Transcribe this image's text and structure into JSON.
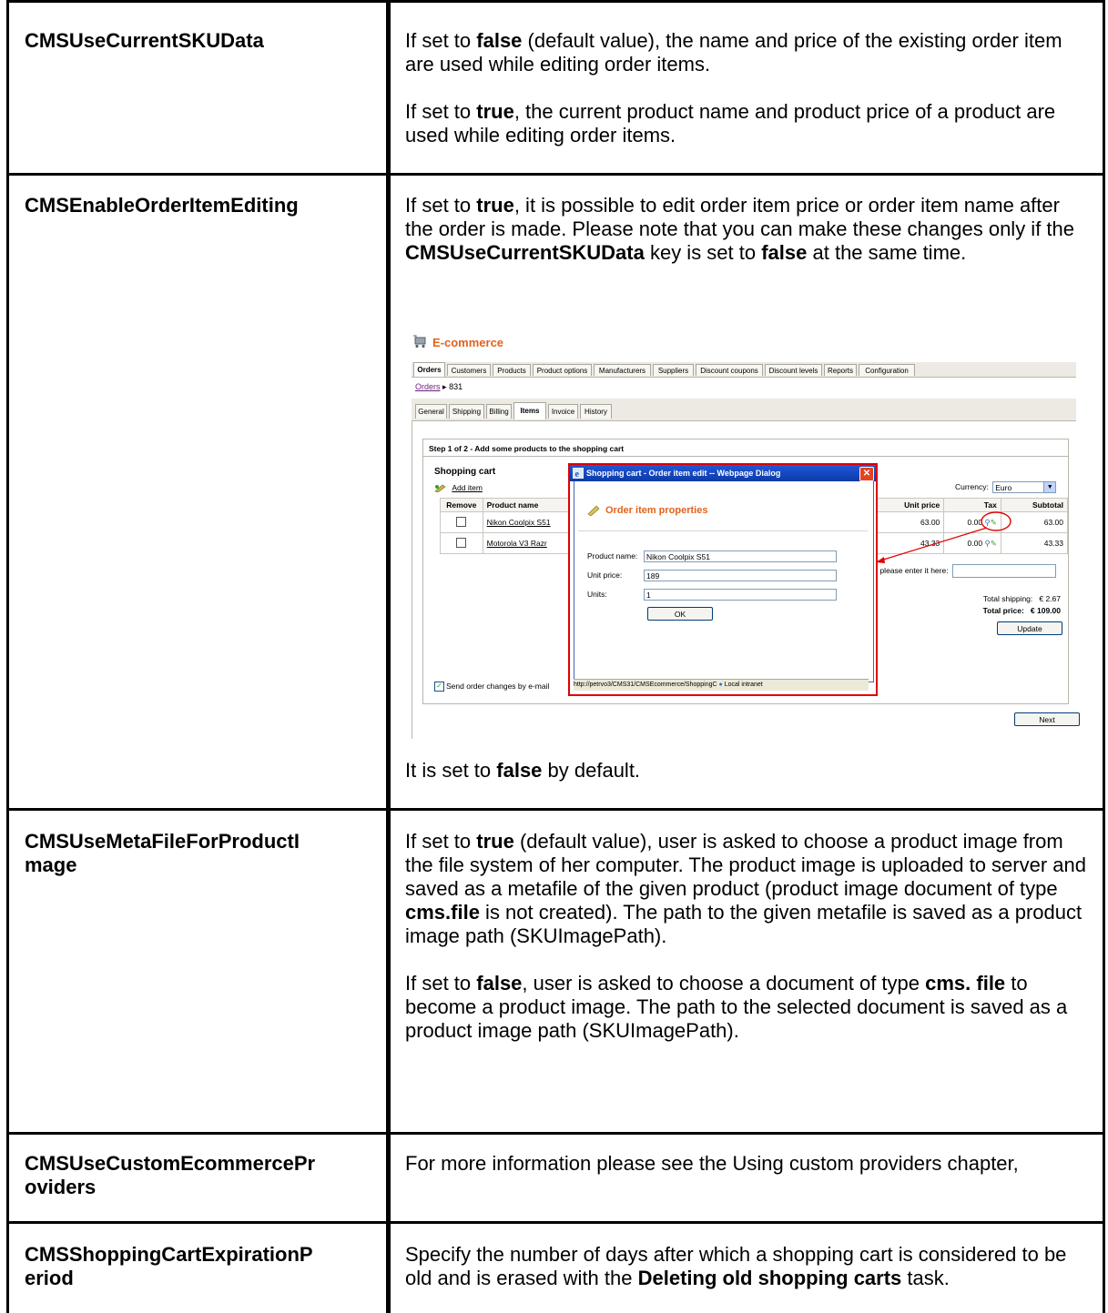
{
  "rows": [
    {
      "key": "CMSUseCurrentSKUData",
      "p1": {
        "a": "If set to ",
        "b": "false",
        "c": " (default value), the name and price of the existing order item are used while editing order  items."
      },
      "p2": {
        "a": "If set to ",
        "b": "true",
        "c": ", the current product name and product price of a product are used while editing order items."
      }
    },
    {
      "key": "CMSEnableOrderItemEditing",
      "p1": {
        "a": "If set to ",
        "b": "true",
        "c": ", it is possible to edit order item price or order item name after the order is made. Please note that you can make these changes only if the ",
        "d": "CMSUseCurrentSKUData",
        "e": " key is set to ",
        "f": "false",
        "g": " at the same time."
      },
      "p2": {
        "a": "It is set to ",
        "b": "false",
        "c": " by default."
      }
    },
    {
      "key": "CMSUseMetaFileForProductImage",
      "key_line1": "CMSUseMetaFileForProductI",
      "key_line2": "mage",
      "p1": {
        "a": "If set to ",
        "b": "true",
        "c": " (default value), user is asked to choose a product image from the file system of her computer. The product image is uploaded to server and saved as a metafile of the given product (product image document of type ",
        "d": "cms.file",
        "e": " is not created).  The path to the given metafile is saved as a product image path (SKUImagePath)."
      },
      "p2": {
        "a": "If set to ",
        "b": "false",
        "c": ", user is asked to choose a document of type ",
        "d": "cms. file",
        "e": " to become a product image. The path to the selected document is saved as a product image path (SKUImagePath)."
      }
    },
    {
      "key": "CMSUseCustomEcommerceProviders",
      "key_line1": "CMSUseCustomEcommercePr",
      "key_line2": "oviders",
      "p1": {
        "a": "For more information please see the Using custom providers chapter,"
      }
    },
    {
      "key": "CMSShoppingCartExpirationPeriod",
      "key_line1": "CMSShoppingCartExpirationP",
      "key_line2": "eriod",
      "p1": {
        "a": "Specify the number of days after which a shopping cart is considered to be old and is erased with the ",
        "b": "Deleting old shopping carts",
        "c": " task."
      }
    }
  ],
  "screenshot": {
    "app_title": "E-commerce",
    "main_tabs": [
      "Orders",
      "Customers",
      "Products",
      "Product options",
      "Manufacturers",
      "Suppliers",
      "Discount coupons",
      "Discount levels",
      "Reports",
      "Configuration"
    ],
    "breadcrumb_link": "Orders",
    "breadcrumb_sep": "▸",
    "breadcrumb_current": "831",
    "sub_tabs": [
      "General",
      "Shipping",
      "Billing",
      "Items",
      "Invoice",
      "History"
    ],
    "step": "Step 1 of 2 - Add some products to the shopping cart",
    "cart_heading": "Shopping cart",
    "add_item": "Add item",
    "currency_label": "Currency:",
    "currency_value": "Euro",
    "columns": {
      "remove": "Remove",
      "product": "Product name",
      "unit_price": "Unit price",
      "tax": "Tax",
      "subtotal": "Subtotal"
    },
    "items": [
      {
        "name": "Nikon Coolpix S51",
        "unit_price": "63.00",
        "tax": "0.00",
        "subtotal": "63.00"
      },
      {
        "name": "Motorola V3 Razr",
        "unit_price": "43.33",
        "tax": "0.00",
        "subtotal": "43.33"
      }
    ],
    "coupon_text": "e, please enter it here:",
    "total_shipping_label": "Total shipping:",
    "total_shipping_value": "€ 2.67",
    "total_price_label": "Total price:",
    "total_price_value": "€ 109.00",
    "update_button": "Update",
    "send_changes": "Send order changes by e-mail",
    "next_button": "Next",
    "dialog": {
      "title": "Shopping cart - Order item edit -- Webpage Dialog",
      "heading": "Order item properties",
      "product_name_label": "Product name:",
      "product_name_value": "Nikon Coolpix S51",
      "unit_price_label": "Unit price:",
      "unit_price_value": "189",
      "units_label": "Units:",
      "units_value": "1",
      "ok_button": "OK",
      "status_url": "http://petrvo3/CMS31/CMSEcommerce/ShoppingC",
      "status_zone": "Local intranet"
    },
    "colors": {
      "title_orange": "#e0631b",
      "dialog_border": "#e00000",
      "link_purple": "#6b1f7a"
    }
  }
}
